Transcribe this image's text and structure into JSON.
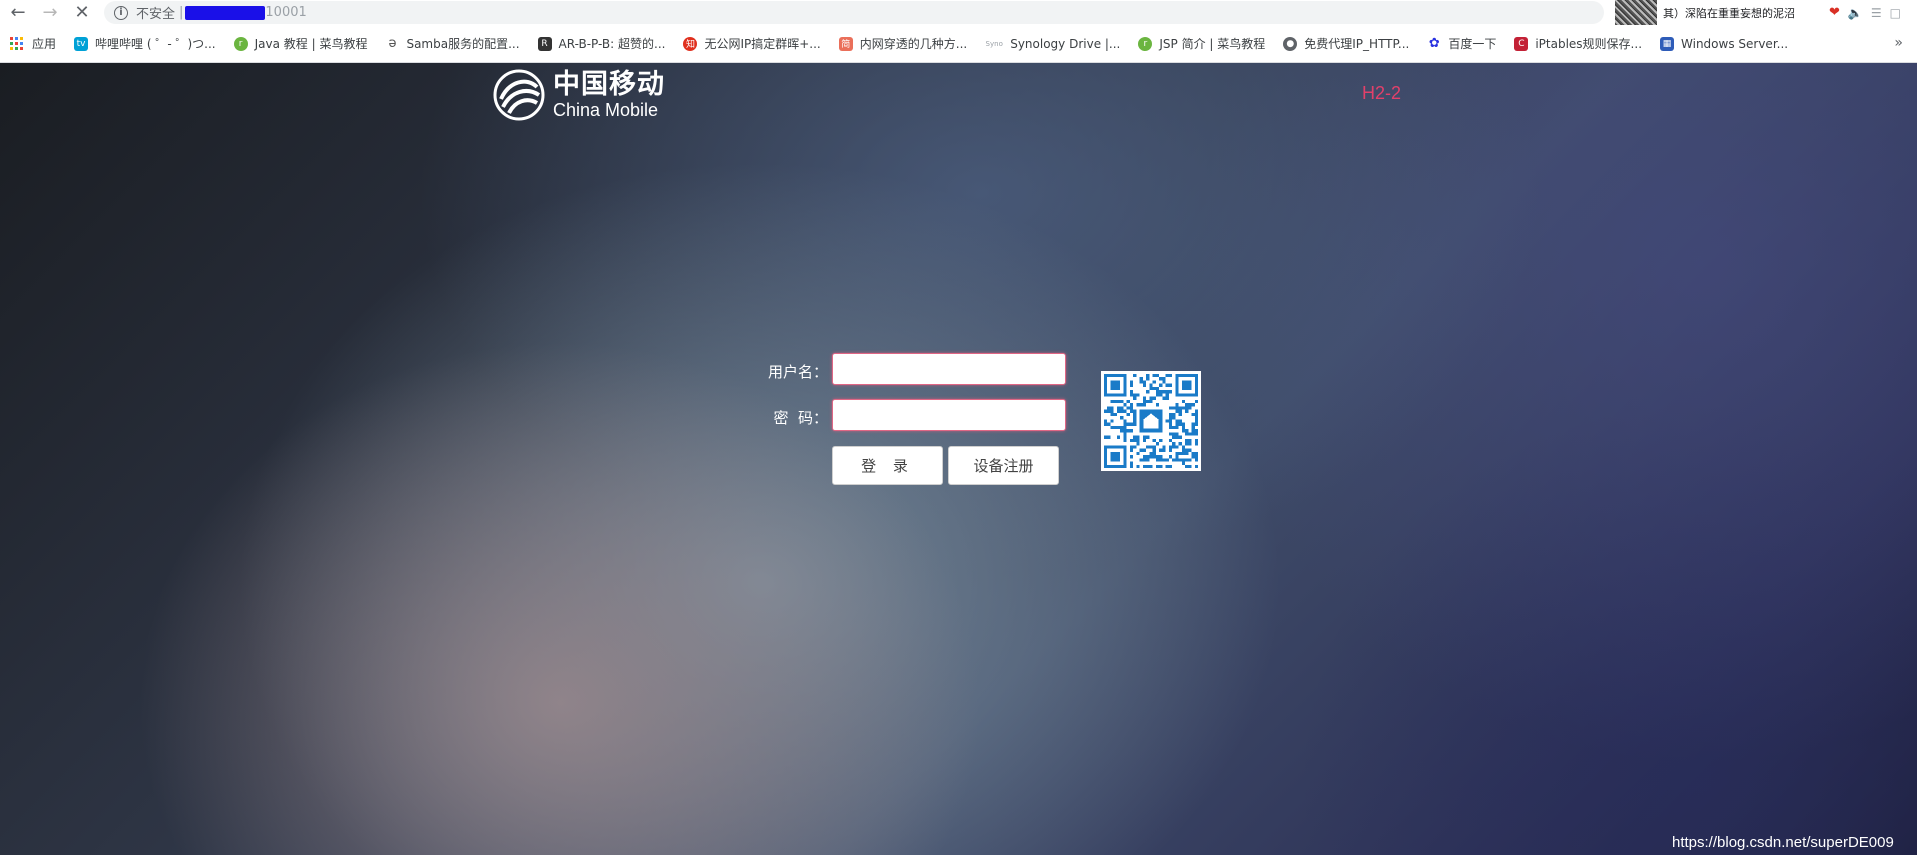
{
  "browser": {
    "security_label": "不安全",
    "url_separator": "|",
    "url_port": "10001",
    "extension": {
      "music_title": "其）深陷在重重妄想的泥沼"
    }
  },
  "bookmarks": [
    {
      "label": "应用",
      "icon": "apps-icon"
    },
    {
      "label": "哔哩哔哩 ( ゜- ゜)つ...",
      "icon": "bilibili-icon",
      "color": "#00a1d6"
    },
    {
      "label": "Java 教程 | 菜鸟教程",
      "icon": "runoob-icon",
      "color": "#6bb540"
    },
    {
      "label": "Samba服务的配置...",
      "icon": "samba-icon",
      "color": "#555555"
    },
    {
      "label": "AR-B-P-B: 超赞的...",
      "icon": "ar-icon",
      "color": "#333333"
    },
    {
      "label": "无公网IP搞定群晖+...",
      "icon": "zhihu-icon",
      "color": "#e0301e"
    },
    {
      "label": "内网穿透的几种方...",
      "icon": "jianshu-icon",
      "color": "#ea6f5a"
    },
    {
      "label": "Synology Drive |...",
      "icon": "synology-icon",
      "color": "#9aa0a6"
    },
    {
      "label": "JSP 简介 | 菜鸟教程",
      "icon": "runoob-icon",
      "color": "#6bb540"
    },
    {
      "label": "免费代理IP_HTTP...",
      "icon": "globe-icon",
      "color": "#5f6368"
    },
    {
      "label": "百度一下",
      "icon": "baidu-icon",
      "color": "#2932e1"
    },
    {
      "label": "iPtables规则保存...",
      "icon": "csdn-icon",
      "color": "#c32136"
    },
    {
      "label": "Windows Server...",
      "icon": "windows-server-icon",
      "color": "#2e5cb8"
    }
  ],
  "page": {
    "logo_cn": "中国移动",
    "logo_en": "China Mobile",
    "device_tag": "H2-2",
    "username_label": "用户名：",
    "password_label": "密  码：",
    "login_button": "登 录",
    "register_button": "设备注册",
    "watermark": "https://blog.csdn.net/superDE009"
  },
  "colors": {
    "accent_pink": "#e2406a",
    "input_border": "#e16785"
  }
}
